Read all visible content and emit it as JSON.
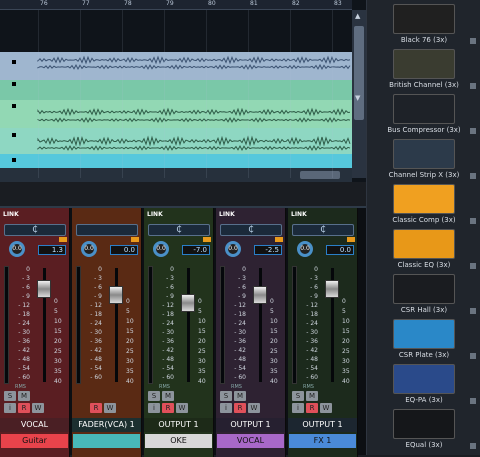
{
  "arrange": {
    "ruler": [
      "76",
      "77",
      "78",
      "79",
      "80",
      "81",
      "82",
      "83"
    ],
    "scroll_up": "▲",
    "scroll_down": "▼"
  },
  "mixer": {
    "strips": [
      {
        "knob": "0.0",
        "value": "1.3",
        "name": "₵",
        "out": "VOCAL",
        "label": "Guitar",
        "link": "LINK",
        "rms": "RMS",
        "s": "S",
        "m": "M",
        "i": "i",
        "r": "R",
        "w": "W",
        "bg": "#5a1e22",
        "labelbg": "#e8434b",
        "outbg": "#4a1f24"
      },
      {
        "knob": "0.0",
        "value": "0.0",
        "name": "",
        "out": "FADER(VCA) 1",
        "label": "",
        "link": "",
        "rms": "",
        "s": "",
        "m": "",
        "i": "",
        "r": "R",
        "w": "W",
        "bg": "#5a2a14",
        "labelbg": "#48b8b8",
        "outbg": "#1c2f30"
      },
      {
        "knob": "0.0",
        "value": "-7.0",
        "name": "₵",
        "out": "OUTPUT 1",
        "label": "OKE",
        "link": "LINK",
        "rms": "RMS",
        "s": "S",
        "m": "M",
        "i": "i",
        "r": "R",
        "w": "W",
        "bg": "#22331c",
        "labelbg": "#d8d8d8",
        "outbg": "#1d2a18"
      },
      {
        "knob": "0.0",
        "value": "-2.5",
        "name": "₵",
        "out": "OUTPUT 1",
        "label": "VOCAL",
        "link": "LINK",
        "rms": "RMS",
        "s": "S",
        "m": "M",
        "i": "i",
        "r": "R",
        "w": "W",
        "bg": "#2e2232",
        "labelbg": "#a868c8",
        "outbg": "#262030"
      },
      {
        "knob": "0.0",
        "value": "0.0",
        "name": "₵",
        "out": "OUTPUT 1",
        "label": "FX 1",
        "link": "LINK",
        "rms": "RMS",
        "s": "S",
        "m": "M",
        "i": "i",
        "r": "R",
        "w": "W",
        "bg": "#1c2a1c",
        "labelbg": "#4a8ad8",
        "outbg": "#1c2630"
      }
    ],
    "scale_left": [
      "0",
      "- 3",
      "- 6",
      "- 9",
      "- 12",
      "- 18",
      "- 24",
      "- 30",
      "- 36",
      "- 42",
      "- 48",
      "- 54",
      "- 60"
    ],
    "scale_right": [
      "0",
      "5",
      "10",
      "15",
      "20",
      "25",
      "30",
      "35",
      "40"
    ]
  },
  "plugins": [
    {
      "name": "Black 76 (3x)",
      "color": "#202020"
    },
    {
      "name": "British Channel (3x)",
      "color": "#3a3c30"
    },
    {
      "name": "Bus Compressor (3x)",
      "color": "#1e2228"
    },
    {
      "name": "Channel Strip X (3x)",
      "color": "#2c3a4a"
    },
    {
      "name": "Classic Comp (3x)",
      "color": "#f0a020"
    },
    {
      "name": "Classic EQ (3x)",
      "color": "#e89818"
    },
    {
      "name": "CSR Hall (3x)",
      "color": "#1a1c20"
    },
    {
      "name": "CSR Plate (3x)",
      "color": "#2a88c8"
    },
    {
      "name": "EQ-PA (3x)",
      "color": "#2a4a8a"
    },
    {
      "name": "EQual (3x)",
      "color": "#15171a"
    }
  ]
}
